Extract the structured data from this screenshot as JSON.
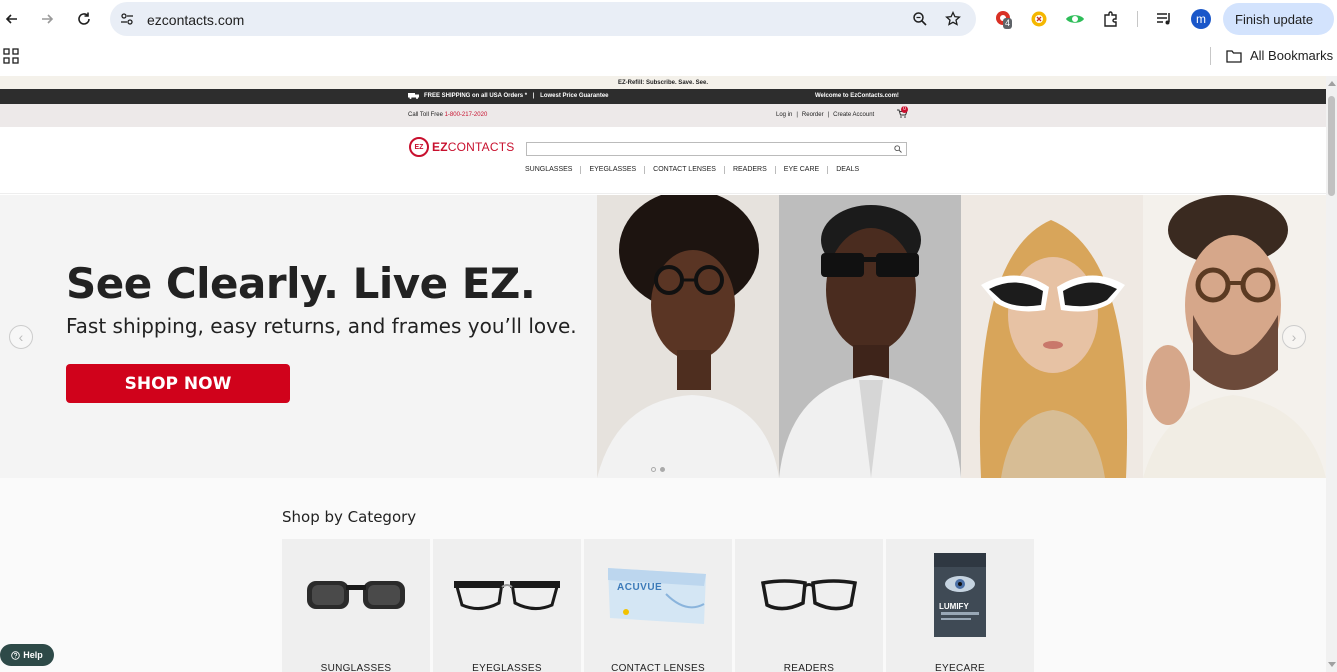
{
  "browser": {
    "url": "ezcontacts.com",
    "extension_badge": "4",
    "avatar_letter": "m",
    "finish_update_label": "Finish update",
    "all_bookmarks_label": "All Bookmarks"
  },
  "site": {
    "promo_text": "EZ-Refill: Subscribe. Save. See.",
    "shipping_text": "FREE SHIPPING on all USA Orders *",
    "price_guarantee": "Lowest Price Guarantee",
    "welcome_text": "Welcome to EzContacts.com!",
    "call_label": "Call Toll Free",
    "phone": "1-800-217-2020",
    "account_links": [
      "Log in",
      "Reorder",
      "Create Account"
    ],
    "cart_count": "0",
    "logo_mark": "EZ",
    "logo_bold": "EZ",
    "logo_rest": "CONTACTS",
    "search_placeholder": "",
    "nav": [
      "SUNGLASSES",
      "EYEGLASSES",
      "CONTACT LENSES",
      "READERS",
      "EYE CARE",
      "DEALS"
    ]
  },
  "hero": {
    "headline": "See Clearly. Live EZ.",
    "subheadline": "Fast shipping, easy returns, and frames you’ll love.",
    "cta_label": "SHOP NOW",
    "prev_arrow": "‹",
    "next_arrow": "›"
  },
  "categories": {
    "title": "Shop by Category",
    "items": [
      {
        "label": "SUNGLASSES"
      },
      {
        "label": "EYEGLASSES"
      },
      {
        "label": "CONTACT LENSES"
      },
      {
        "label": "READERS"
      },
      {
        "label": "EYECARE"
      }
    ],
    "acuvue_text": "ACUVUE",
    "lumify_text": "LUMIFY"
  },
  "help": {
    "label": "Help"
  },
  "colors": {
    "brand_red": "#d0021b",
    "chrome_blue": "#d3e3fd",
    "omnibox": "#e9eef6"
  }
}
